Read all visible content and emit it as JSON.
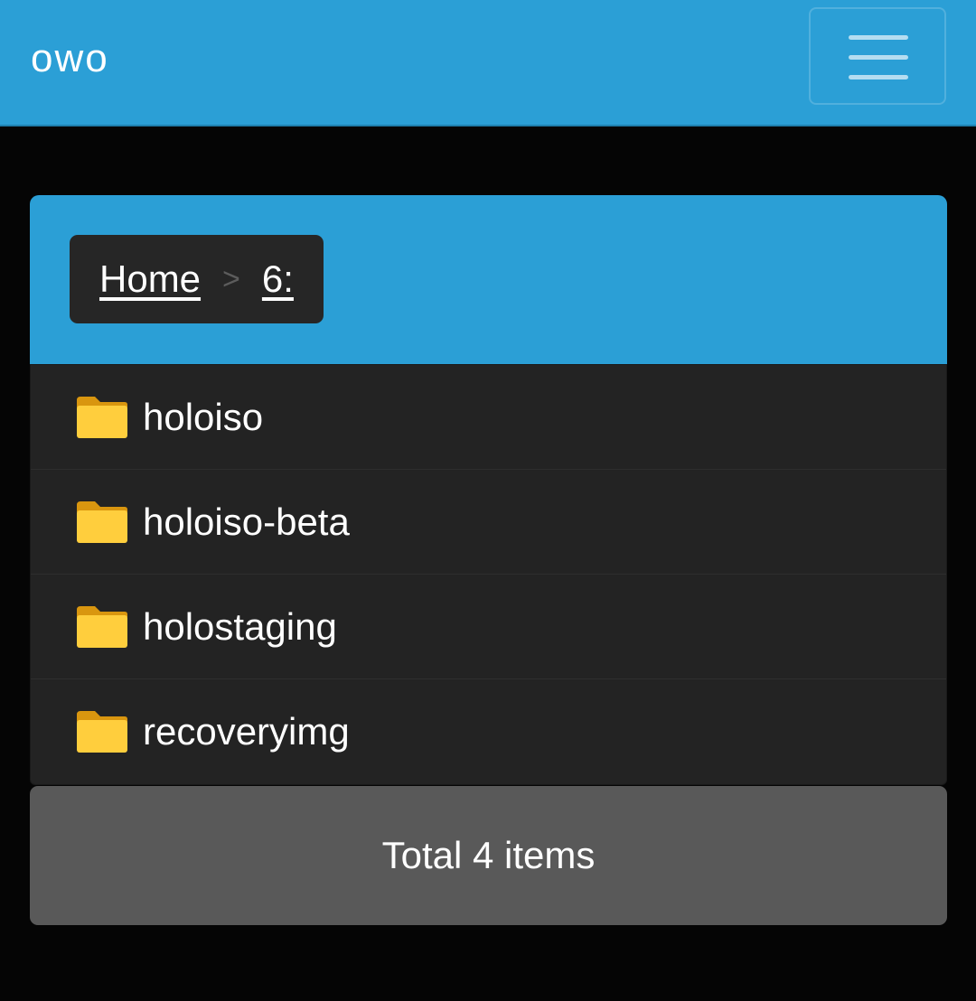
{
  "navbar": {
    "brand": "owo",
    "menu_icon": "hamburger-menu-icon"
  },
  "breadcrumb": {
    "items": [
      {
        "label": "Home"
      },
      {
        "label": "6:"
      }
    ],
    "separator": ">"
  },
  "files": {
    "items": [
      {
        "name": "holoiso",
        "icon": "folder-icon"
      },
      {
        "name": "holoiso-beta",
        "icon": "folder-icon"
      },
      {
        "name": "holostaging",
        "icon": "folder-icon"
      },
      {
        "name": "recoveryimg",
        "icon": "folder-icon"
      }
    ]
  },
  "footer": {
    "total_label": "Total 4 items"
  },
  "colors": {
    "accent": "#2b9fd6",
    "background": "#050505",
    "list_background": "#232323",
    "breadcrumb_background": "#262626",
    "footer_background": "#595959",
    "folder_yellow": "#ffce3d"
  }
}
